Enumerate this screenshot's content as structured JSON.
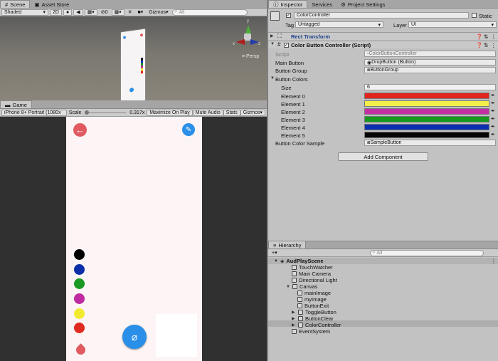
{
  "scene": {
    "tabs": [
      {
        "label": "Scene"
      },
      {
        "label": "Asset Store"
      }
    ],
    "shading": "Shaded",
    "mode_2d": "2D",
    "hidden_count": "0",
    "gizmos": "Gizmos",
    "search_placeholder": "All",
    "persp": "Persp",
    "axis_y": "y",
    "axis_x": "x",
    "axis_z": "z"
  },
  "game": {
    "tab": "Game",
    "resolution": "iPhone 8+ Portrait (1080x",
    "scale_label": "Scale",
    "scale_value": "0.317x",
    "maximize": "Maximize On Play",
    "mute": "Mute Audio",
    "stats": "Stats",
    "gizmos": "Gizmos",
    "palette": [
      "#000000",
      "#0b2fa8",
      "#1a9a22",
      "#c02aa0",
      "#f2ea30",
      "#e02a20"
    ],
    "accent": "#e05a60",
    "fab_color": "#2a8fe8"
  },
  "inspector": {
    "tabs": [
      {
        "label": "Inspector"
      },
      {
        "label": "Services"
      },
      {
        "label": "Project Settings"
      }
    ],
    "object_name": "ColorController",
    "static_label": "Static",
    "tag_label": "Tag",
    "tag_value": "Untagged",
    "layer_label": "Layer",
    "layer_value": "UI",
    "rect_transform": "Rect Transform",
    "script_header": "Color Button Controller (Script)",
    "script_label": "Script",
    "script_value": "ColorButtonController",
    "main_button_label": "Main Button",
    "main_button_value": "DropButton (Button)",
    "button_group_label": "Button Group",
    "button_group_value": "ButtonGroup",
    "button_colors_label": "Button Colors",
    "size_label": "Size",
    "size_value": "6",
    "elements": [
      {
        "label": "Element 0",
        "color": "#e2241c"
      },
      {
        "label": "Element 1",
        "color": "#f4ee48"
      },
      {
        "label": "Element 2",
        "color": "#c42fa6"
      },
      {
        "label": "Element 3",
        "color": "#169a1e"
      },
      {
        "label": "Element 4",
        "color": "#0a2fb0"
      },
      {
        "label": "Element 5",
        "color": "#050505"
      }
    ],
    "sample_label": "Button Color Sample",
    "sample_value": "SampleButton",
    "add_component": "Add Component"
  },
  "hierarchy": {
    "tab": "Hierarchy",
    "add_label": "+",
    "search_placeholder": "All",
    "items": [
      {
        "label": "AudPlayScene"
      },
      {
        "label": "TouchWatcher"
      },
      {
        "label": "Main Camera"
      },
      {
        "label": "Directional Light"
      },
      {
        "label": "Canvas"
      },
      {
        "label": "mainImage"
      },
      {
        "label": "myImage"
      },
      {
        "label": "ButtonExit"
      },
      {
        "label": "ToggleButton"
      },
      {
        "label": "ButtonClear"
      },
      {
        "label": "ColorController"
      },
      {
        "label": "EventSystem"
      }
    ]
  }
}
